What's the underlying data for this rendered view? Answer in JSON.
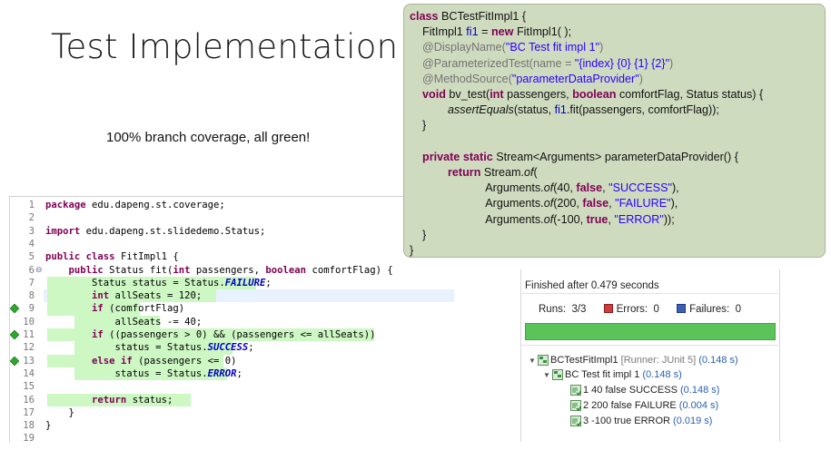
{
  "slide": {
    "title": "Test Implementation",
    "subtitle": "100% branch coverage, all green!"
  },
  "editor": {
    "line_numbers": [
      "1",
      "2",
      "3",
      "4",
      "5",
      "6",
      "7",
      "8",
      "9",
      "10",
      "11",
      "12",
      "13",
      "14",
      "15",
      "16",
      "17",
      "18",
      "19"
    ],
    "lines": [
      {
        "n": "1",
        "parts": [
          {
            "t": "package",
            "c": "kw"
          },
          {
            "t": " edu.dapeng.st.coverage;"
          }
        ]
      },
      {
        "n": "2",
        "parts": []
      },
      {
        "n": "3",
        "parts": [
          {
            "t": "import",
            "c": "kw"
          },
          {
            "t": " edu.dapeng.st.slidedemo.Status;"
          }
        ]
      },
      {
        "n": "4",
        "parts": []
      },
      {
        "n": "5",
        "parts": [
          {
            "t": "public",
            "c": "kw"
          },
          {
            "t": " "
          },
          {
            "t": "class",
            "c": "kw"
          },
          {
            "t": " FitImpl1 {"
          }
        ]
      },
      {
        "n": "6",
        "parts": [
          {
            "t": "    "
          },
          {
            "t": "public",
            "c": "kw"
          },
          {
            "t": " Status fit("
          },
          {
            "t": "int",
            "c": "kw"
          },
          {
            "t": " passengers, "
          },
          {
            "t": "boolean",
            "c": "kw"
          },
          {
            "t": " comfortFlag) {"
          }
        ]
      },
      {
        "n": "7",
        "parts": [
          {
            "t": "        Status status = Status."
          },
          {
            "t": "FAILURE",
            "c": "st"
          },
          {
            "t": ";"
          }
        ]
      },
      {
        "n": "8",
        "parts": [
          {
            "t": "        "
          },
          {
            "t": "int",
            "c": "kw"
          },
          {
            "t": " allSeats = 120;"
          }
        ]
      },
      {
        "n": "9",
        "parts": [
          {
            "t": "        "
          },
          {
            "t": "if",
            "c": "kw"
          },
          {
            "t": " (comfortFlag)"
          }
        ]
      },
      {
        "n": "10",
        "parts": [
          {
            "t": "            allSeats -= 40;"
          }
        ]
      },
      {
        "n": "11",
        "parts": [
          {
            "t": "        "
          },
          {
            "t": "if",
            "c": "kw"
          },
          {
            "t": " ((passengers > 0) && (passengers <= allSeats))"
          }
        ]
      },
      {
        "n": "12",
        "parts": [
          {
            "t": "            status = Status."
          },
          {
            "t": "SUCCESS",
            "c": "st"
          },
          {
            "t": ";"
          }
        ]
      },
      {
        "n": "13",
        "parts": [
          {
            "t": "        "
          },
          {
            "t": "else",
            "c": "kw"
          },
          {
            "t": " "
          },
          {
            "t": "if",
            "c": "kw"
          },
          {
            "t": " (passengers <= 0)"
          }
        ]
      },
      {
        "n": "14",
        "parts": [
          {
            "t": "            status = Status."
          },
          {
            "t": "ERROR",
            "c": "st"
          },
          {
            "t": ";"
          }
        ]
      },
      {
        "n": "15",
        "parts": []
      },
      {
        "n": "16",
        "parts": [
          {
            "t": "        "
          },
          {
            "t": "return",
            "c": "kw"
          },
          {
            "t": " status;"
          }
        ]
      },
      {
        "n": "17",
        "parts": [
          {
            "t": "    }"
          }
        ]
      },
      {
        "n": "18",
        "parts": [
          {
            "t": "}"
          }
        ]
      },
      {
        "n": "19",
        "parts": []
      }
    ]
  },
  "popup": {
    "lines": [
      [
        {
          "t": "class",
          "c": "pk"
        },
        {
          "t": " BCTestFitImpl1 {"
        }
      ],
      [
        {
          "t": "    FitImpl1 "
        },
        {
          "t": "fi1",
          "c": "pv"
        },
        {
          "t": " = "
        },
        {
          "t": "new",
          "c": "pk"
        },
        {
          "t": " FitImpl1( );"
        }
      ],
      [
        {
          "t": "    @DisplayName(",
          "c": "pa"
        },
        {
          "t": "\"BC Test fit impl 1\"",
          "c": "ps"
        },
        {
          "t": ")",
          "c": "pa"
        }
      ],
      [
        {
          "t": "    @ParameterizedTest(",
          "c": "pa"
        },
        {
          "t": "name = ",
          "c": "pa"
        },
        {
          "t": "\"{index} {0} {1} {2}\"",
          "c": "ps"
        },
        {
          "t": ")",
          "c": "pa"
        }
      ],
      [
        {
          "t": "    @MethodSource(",
          "c": "pa"
        },
        {
          "t": "\"parameterDataProvider\"",
          "c": "ps"
        },
        {
          "t": ")",
          "c": "pa"
        }
      ],
      [
        {
          "t": "    "
        },
        {
          "t": "void",
          "c": "pk"
        },
        {
          "t": " bv_test("
        },
        {
          "t": "int",
          "c": "pk"
        },
        {
          "t": " passengers, "
        },
        {
          "t": "boolean",
          "c": "pk"
        },
        {
          "t": " comfortFlag, Status status) {"
        }
      ],
      [
        {
          "t": "            "
        },
        {
          "t": "assertEquals",
          "c": "pi"
        },
        {
          "t": "(status, "
        },
        {
          "t": "fi1",
          "c": "pv"
        },
        {
          "t": ".fit(passengers, comfortFlag));"
        }
      ],
      [
        {
          "t": "    }"
        }
      ],
      [],
      [
        {
          "t": "    "
        },
        {
          "t": "private",
          "c": "pk"
        },
        {
          "t": " "
        },
        {
          "t": "static",
          "c": "pk"
        },
        {
          "t": " Stream<Arguments> parameterDataProvider() {"
        }
      ],
      [
        {
          "t": "            "
        },
        {
          "t": "return",
          "c": "pk"
        },
        {
          "t": " Stream."
        },
        {
          "t": "of",
          "c": "pi"
        },
        {
          "t": "("
        }
      ],
      [
        {
          "t": "                        Arguments."
        },
        {
          "t": "of",
          "c": "pi"
        },
        {
          "t": "(40, "
        },
        {
          "t": "false",
          "c": "pk"
        },
        {
          "t": ", "
        },
        {
          "t": "\"SUCCESS\"",
          "c": "ps"
        },
        {
          "t": "),"
        }
      ],
      [
        {
          "t": "                        Arguments."
        },
        {
          "t": "of",
          "c": "pi"
        },
        {
          "t": "(200, "
        },
        {
          "t": "false",
          "c": "pk"
        },
        {
          "t": ", "
        },
        {
          "t": "\"FAILURE\"",
          "c": "ps"
        },
        {
          "t": "),"
        }
      ],
      [
        {
          "t": "                        Arguments."
        },
        {
          "t": "of",
          "c": "pi"
        },
        {
          "t": "(-100, "
        },
        {
          "t": "true",
          "c": "pk"
        },
        {
          "t": ", "
        },
        {
          "t": "\"ERROR\"",
          "c": "ps"
        },
        {
          "t": "));"
        }
      ],
      [
        {
          "t": "    }"
        }
      ],
      [
        {
          "t": "}"
        }
      ]
    ]
  },
  "junit": {
    "finished": "Finished after 0.479 seconds",
    "runs_label": "Runs:",
    "runs_value": "3/3",
    "errors_label": "Errors:",
    "errors_value": "0",
    "failures_label": "Failures:",
    "failures_value": "0",
    "progress": 1.0,
    "tree": {
      "root_name": "BCTestFitImpl1",
      "root_runner": "[Runner: JUnit 5]",
      "root_time": "(0.148 s)",
      "child_name": "BC Test fit impl 1",
      "child_time": "(0.148 s)",
      "cases": [
        {
          "name": "1 40 false SUCCESS",
          "time": "(0.148 s)"
        },
        {
          "name": "2 200 false FAILURE",
          "time": "(0.004 s)"
        },
        {
          "name": "3 -100 true ERROR",
          "time": "(0.019 s)"
        }
      ]
    }
  },
  "colors": {
    "coverage_green": "#cdf7c3",
    "popup_bg": "#cfdbbf",
    "keyword": "#7f0055",
    "progress_green": "#5ac35a"
  }
}
